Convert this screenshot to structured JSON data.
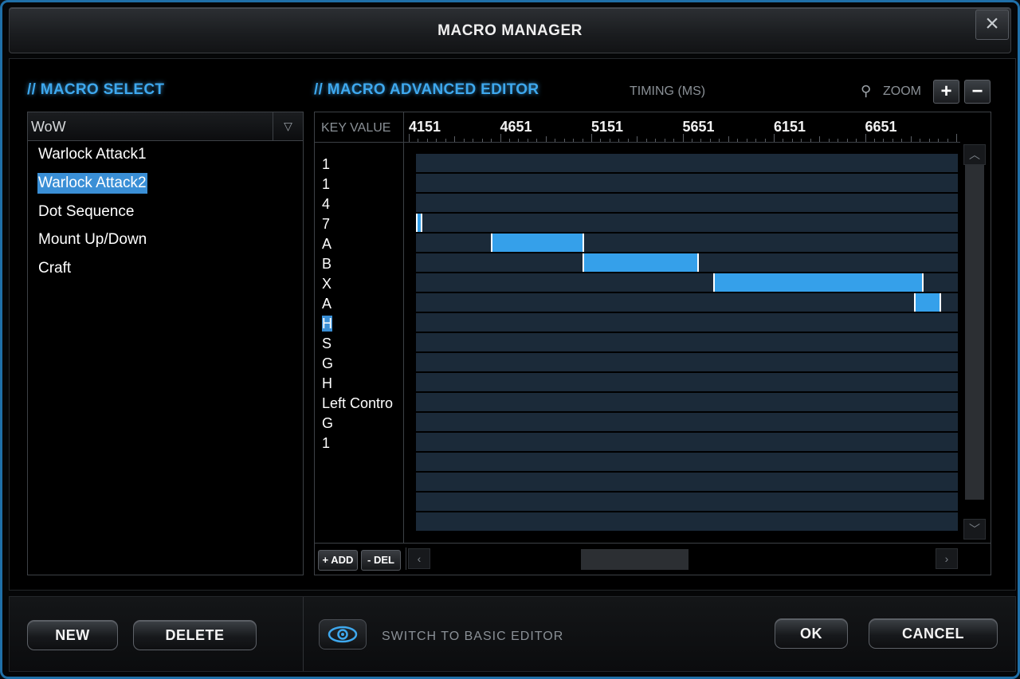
{
  "window": {
    "title": "MACRO MANAGER"
  },
  "macro_select": {
    "title": "// MACRO SELECT",
    "group": "WoW",
    "items": [
      "Warlock Attack1",
      "Warlock Attack2",
      "Dot Sequence",
      "Mount Up/Down",
      "Craft"
    ],
    "selected": "Warlock Attack2"
  },
  "editor": {
    "title": "// MACRO ADVANCED EDITOR",
    "timing_label": "TIMING (MS)",
    "zoom_label": "ZOOM",
    "zoom_in": "+",
    "zoom_out": "−",
    "key_value_header": "KEY VALUE",
    "ruler_labels": [
      "4151",
      "4651",
      "5151",
      "5651",
      "6151",
      "6651"
    ],
    "keys": [
      "1",
      "1",
      "4",
      "7",
      "A",
      "B",
      "X",
      "A",
      "H",
      "S",
      "G",
      "H",
      "Left Contro",
      "G",
      "1"
    ],
    "selected_key_index": 8,
    "events_ms": [
      {
        "row": 3,
        "start": 4151,
        "end": 4196
      },
      {
        "row": 4,
        "start": 4601,
        "end": 5111
      },
      {
        "row": 5,
        "start": 5101,
        "end": 5741
      },
      {
        "row": 6,
        "start": 5821,
        "end": 6971
      },
      {
        "row": 7,
        "start": 6921,
        "end": 7066
      }
    ],
    "add_label": "+ ADD",
    "del_label": "- DEL"
  },
  "footer": {
    "new_label": "NEW",
    "delete_label": "DELETE",
    "switch_label": "SWITCH TO BASIC EDITOR",
    "ok_label": "OK",
    "cancel_label": "CANCEL"
  },
  "colors": {
    "accent": "#3ea8ee",
    "bar": "#35a0ea",
    "track": "#1b2a39"
  }
}
